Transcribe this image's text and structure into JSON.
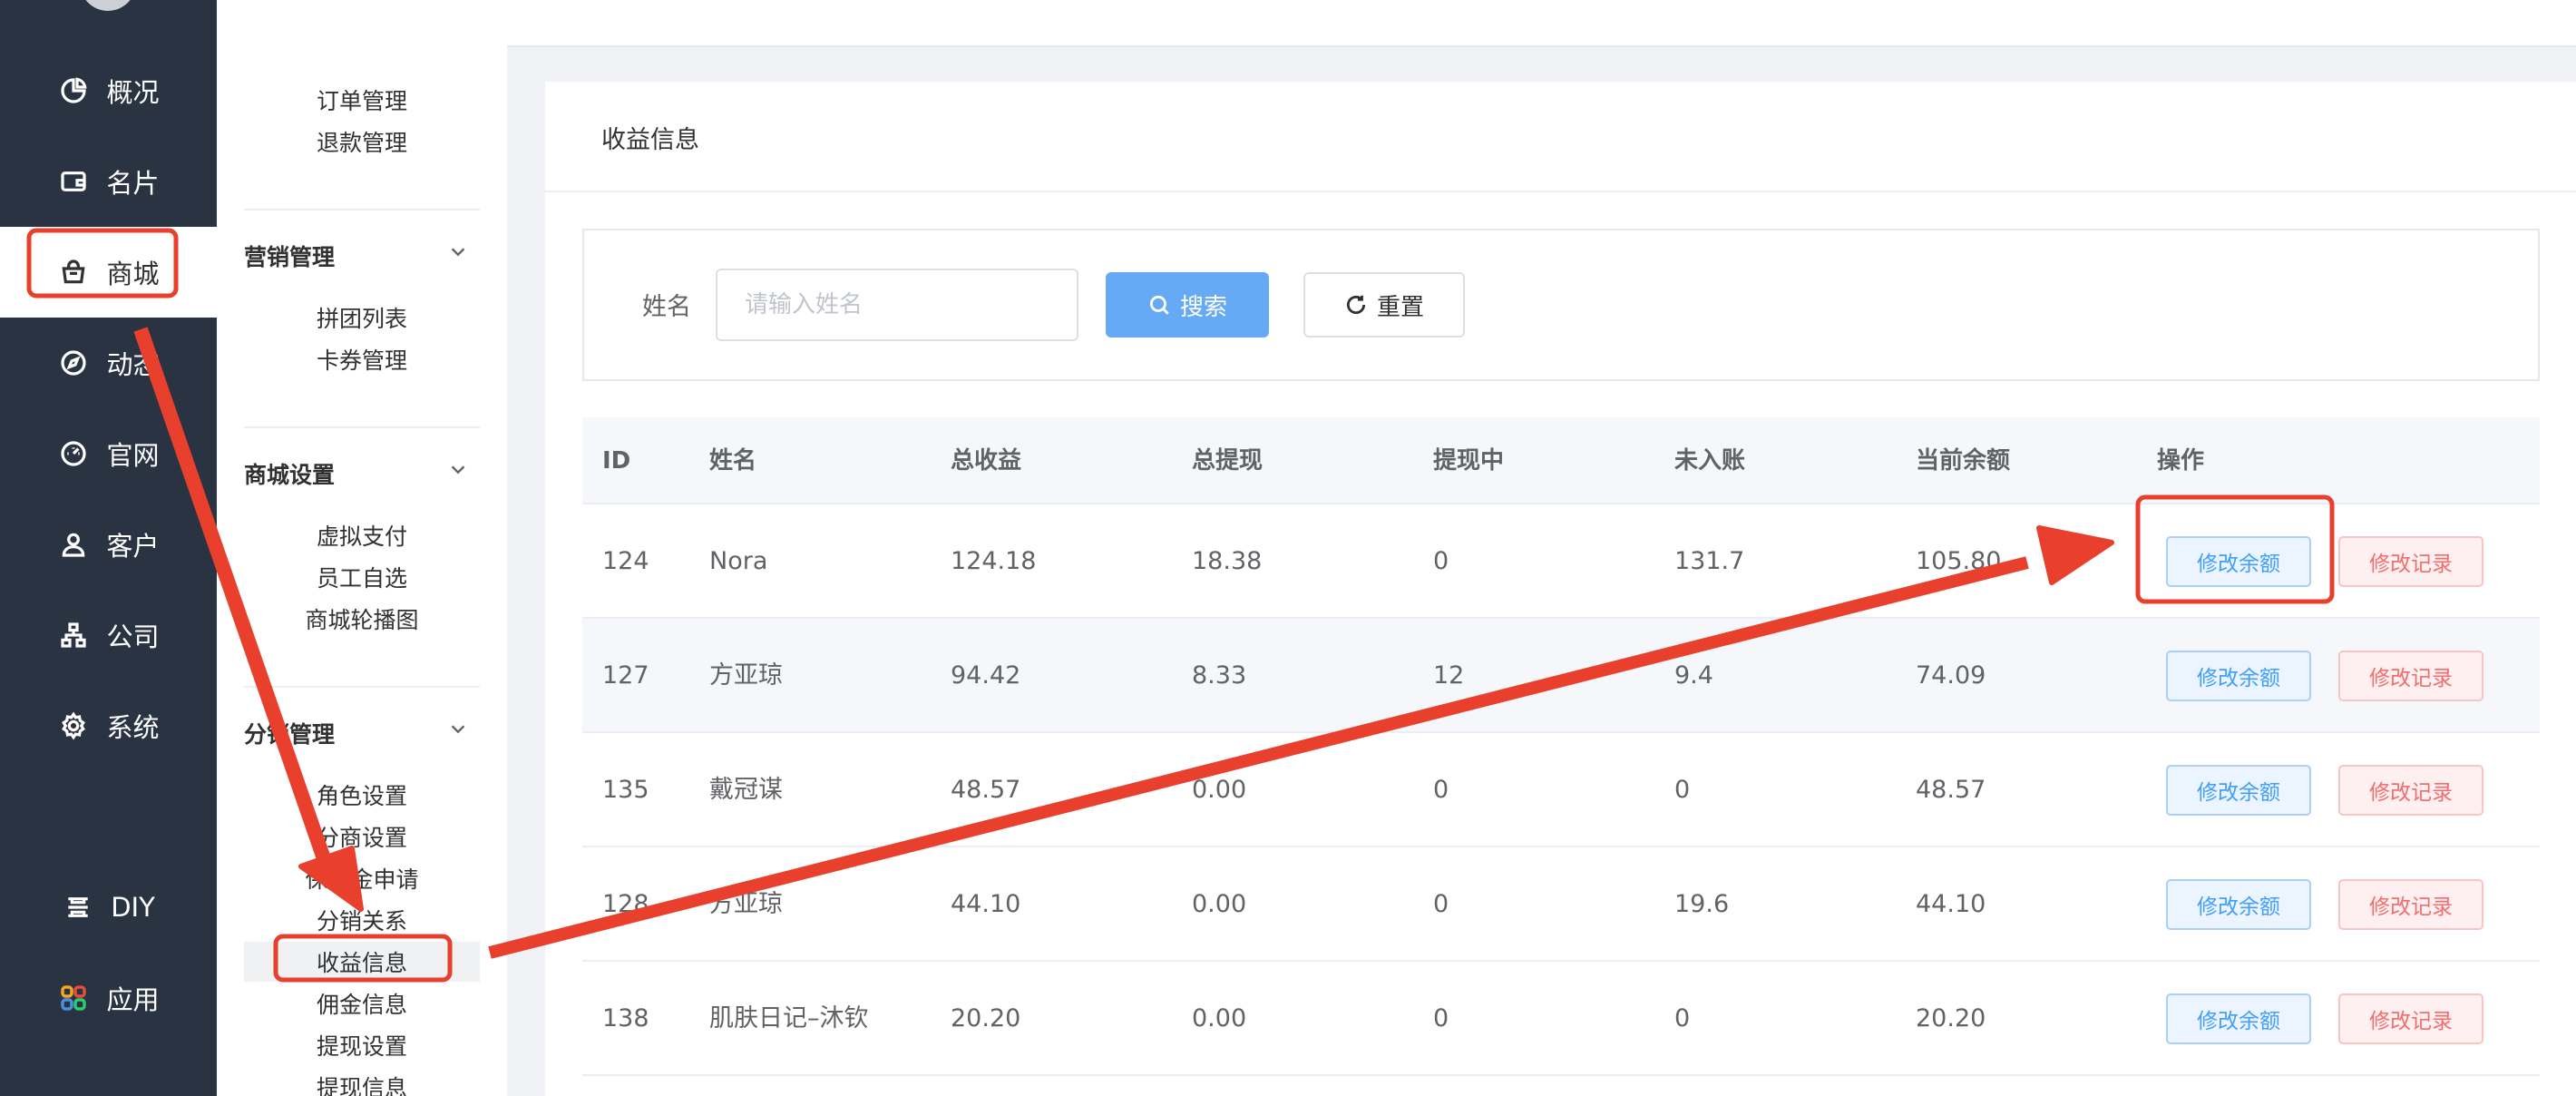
{
  "rail": {
    "items": [
      {
        "label": "概况",
        "icon": "pie-chart-icon"
      },
      {
        "label": "名片",
        "icon": "wallet-icon"
      },
      {
        "label": "商城",
        "icon": "shopping-bag-icon",
        "active": true
      },
      {
        "label": "动态",
        "icon": "compass-icon"
      },
      {
        "label": "官网",
        "icon": "dashboard-icon"
      },
      {
        "label": "客户",
        "icon": "user-icon"
      },
      {
        "label": "公司",
        "icon": "org-chart-icon"
      },
      {
        "label": "系统",
        "icon": "gear-icon"
      }
    ],
    "diy_label": "DIY",
    "apps_label": "应用"
  },
  "submenu": {
    "order_group": {
      "items": [
        "订单管理",
        "退款管理"
      ]
    },
    "marketing_group": {
      "title": "营销管理",
      "items": [
        "拼团列表",
        "卡券管理"
      ]
    },
    "shop_group": {
      "title": "商城设置",
      "items": [
        "虚拟支付",
        "员工自选",
        "商城轮播图"
      ]
    },
    "distribution_group": {
      "title": "分销管理",
      "items": [
        "角色设置",
        "分商设置",
        "保证金申请",
        "分销关系",
        "收益信息",
        "佣金信息",
        "提现设置",
        "提现信息"
      ],
      "selected": "收益信息"
    }
  },
  "card": {
    "title": "收益信息"
  },
  "search": {
    "label": "姓名",
    "placeholder": "请输入姓名",
    "search_button": "搜索",
    "reset_button": "重置"
  },
  "table": {
    "columns": [
      "ID",
      "姓名",
      "总收益",
      "总提现",
      "提现中",
      "未入账",
      "当前余额",
      "操作"
    ],
    "rows": [
      {
        "id": "124",
        "name": "Nora",
        "total_income": "124.18",
        "total_withdrawn": "18.38",
        "withdrawing": "0",
        "unsettled": "131.7",
        "balance": "105.80"
      },
      {
        "id": "127",
        "name": "方亚琼",
        "total_income": "94.42",
        "total_withdrawn": "8.33",
        "withdrawing": "12",
        "unsettled": "9.4",
        "balance": "74.09"
      },
      {
        "id": "135",
        "name": "戴冠谋",
        "total_income": "48.57",
        "total_withdrawn": "0.00",
        "withdrawing": "0",
        "unsettled": "0",
        "balance": "48.57"
      },
      {
        "id": "128",
        "name": "方亚琼",
        "total_income": "44.10",
        "total_withdrawn": "0.00",
        "withdrawing": "0",
        "unsettled": "19.6",
        "balance": "44.10"
      },
      {
        "id": "138",
        "name": "肌肤日记–沐钦",
        "total_income": "20.20",
        "total_withdrawn": "0.00",
        "withdrawing": "0",
        "unsettled": "0",
        "balance": "20.20"
      }
    ],
    "edit_balance_label": "修改余额",
    "edit_log_label": "修改记录"
  },
  "colors": {
    "rail_bg": "#2a3342",
    "primary": "#409eff",
    "search_button": "#66a9f5",
    "danger": "#f56c6c",
    "annotation": "#e8402c"
  }
}
